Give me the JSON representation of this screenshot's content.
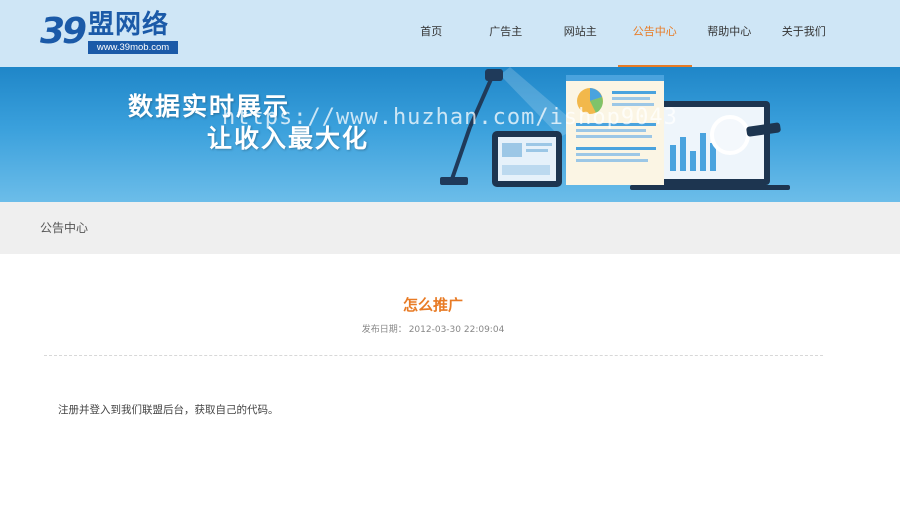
{
  "header": {
    "logo_number": "39",
    "logo_text": "盟网络",
    "logo_url": "www.39mob.com",
    "nav": [
      {
        "label": "首页",
        "active": false
      },
      {
        "label": "广告主",
        "active": false
      },
      {
        "label": "网站主",
        "active": false
      },
      {
        "label": "公告中心",
        "active": true
      },
      {
        "label": "帮助中心",
        "active": false
      },
      {
        "label": "关于我们",
        "active": false
      }
    ]
  },
  "banner": {
    "line1": "数据实时展示",
    "line2": "让收入最大化",
    "watermark": "https://www.huzhan.com/ishop9043"
  },
  "breadcrumb": {
    "label": "公告中心"
  },
  "article": {
    "title": "怎么推广",
    "date_label": "发布日期：",
    "date_value": "2012-03-30 22:09:04",
    "body": "注册并登入到我们联盟后台，获取自己的代码。"
  },
  "colors": {
    "accent": "#e87b25",
    "brand": "#1b5aa8",
    "header_bg": "#cfe6f6",
    "crumb_bg": "#efefef"
  }
}
